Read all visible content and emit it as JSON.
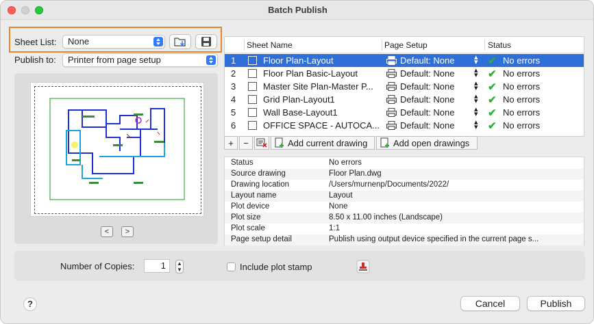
{
  "window": {
    "title": "Batch Publish"
  },
  "sheet_list": {
    "label": "Sheet List:",
    "value": "None"
  },
  "publish_to": {
    "label": "Publish to:",
    "value": "Printer from page setup"
  },
  "table": {
    "headers": {
      "sheet_name": "Sheet Name",
      "page_setup": "Page Setup",
      "status": "Status"
    },
    "rows": [
      {
        "num": "1",
        "sheet": "Floor Plan-Layout",
        "page_setup": "Default: None",
        "status": "No errors"
      },
      {
        "num": "2",
        "sheet": "Floor Plan Basic-Layout",
        "page_setup": "Default: None",
        "status": "No errors"
      },
      {
        "num": "3",
        "sheet": "Master Site Plan-Master P...",
        "page_setup": "Default: None",
        "status": "No errors"
      },
      {
        "num": "4",
        "sheet": "Grid Plan-Layout1",
        "page_setup": "Default: None",
        "status": "No errors"
      },
      {
        "num": "5",
        "sheet": "Wall Base-Layout1",
        "page_setup": "Default: None",
        "status": "No errors"
      },
      {
        "num": "6",
        "sheet": "OFFICE SPACE - AUTOCA...",
        "page_setup": "Default: None",
        "status": "No errors"
      }
    ],
    "selected_row": 1
  },
  "toolbar": {
    "add_label": "+",
    "remove_label": "−",
    "add_current": "Add current drawing",
    "add_open": "Add open drawings"
  },
  "details": [
    {
      "key": "Status",
      "value": "No errors"
    },
    {
      "key": "Source drawing",
      "value": "Floor Plan.dwg"
    },
    {
      "key": "Drawing location",
      "value": "/Users/murnenp/Documents/2022/"
    },
    {
      "key": "Layout name",
      "value": "Layout"
    },
    {
      "key": "Plot device",
      "value": "None"
    },
    {
      "key": "Plot size",
      "value": "8.50 x 11.00 inches (Landscape)"
    },
    {
      "key": "Plot scale",
      "value": "1:1"
    },
    {
      "key": "Page setup detail",
      "value": "Publish using output device specified in the current page s..."
    }
  ],
  "copies": {
    "label": "Number of Copies:",
    "value": "1"
  },
  "plot_stamp": {
    "label": "Include plot stamp",
    "checked": false
  },
  "buttons": {
    "help": "?",
    "cancel": "Cancel",
    "publish": "Publish"
  },
  "preview_nav": {
    "prev": "<",
    "next": ">"
  },
  "colors": {
    "selection": "#2f6fd8",
    "highlight_box": "#e8842c",
    "check": "#2fae3b"
  }
}
